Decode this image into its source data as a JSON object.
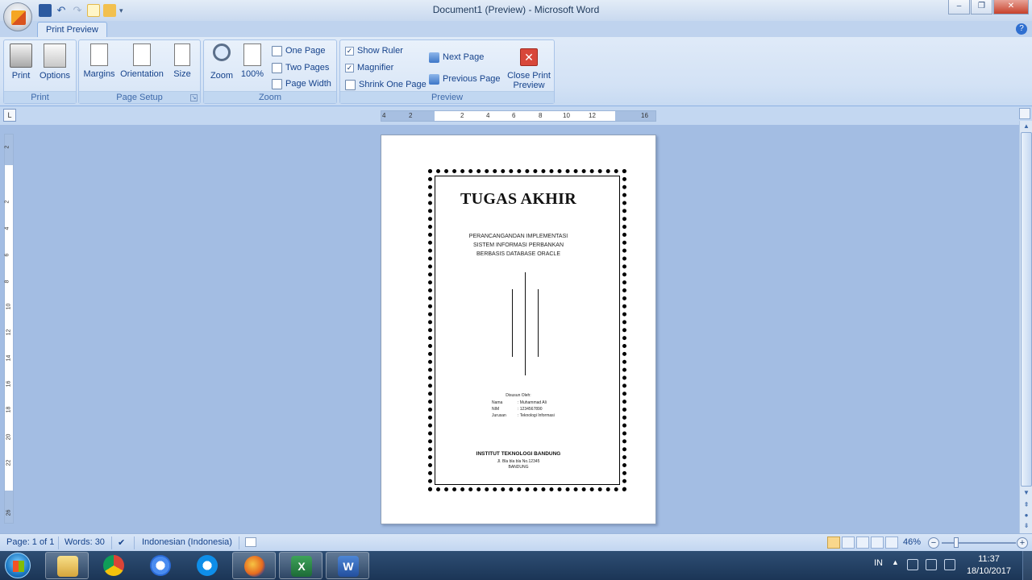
{
  "window": {
    "title": "Document1 (Preview) - Microsoft Word",
    "minimize": "–",
    "restore": "❐",
    "close": "✕"
  },
  "quick_access": {
    "undo": "↶",
    "redo": "↷",
    "more": "▾"
  },
  "ribbon": {
    "active_tab": "Print Preview",
    "help": "?",
    "groups": {
      "print": {
        "label": "Print",
        "print_label": "Print",
        "options_label": "Options"
      },
      "page_setup": {
        "label": "Page Setup",
        "margins_label": "Margins",
        "orientation_label": "Orientation",
        "size_label": "Size"
      },
      "zoom": {
        "label": "Zoom",
        "zoom_label": "Zoom",
        "hundred_label": "100%",
        "one_page_label": "One Page",
        "two_pages_label": "Two Pages",
        "page_width_label": "Page Width"
      },
      "preview": {
        "label": "Preview",
        "show_ruler_label": "Show Ruler",
        "show_ruler_checked": true,
        "magnifier_label": "Magnifier",
        "magnifier_checked": true,
        "shrink_label": "Shrink One Page",
        "next_page_label": "Next Page",
        "previous_page_label": "Previous Page",
        "close_preview_label_1": "Close Print",
        "close_preview_label_2": "Preview"
      }
    }
  },
  "ruler": {
    "tab_selector": "L",
    "h_ticks": [
      "4",
      "2",
      "2",
      "4",
      "6",
      "8",
      "10",
      "12",
      "16"
    ],
    "v_ticks": [
      "2",
      "2",
      "4",
      "6",
      "8",
      "10",
      "12",
      "14",
      "16",
      "18",
      "20",
      "22",
      "26"
    ]
  },
  "document": {
    "title": "TUGAS AKHIR",
    "subtitle_1": "PERANCANGANDAN IMPLEMENTASI",
    "subtitle_2": "SISTEM INFORMASI PERBANKAN",
    "subtitle_3": "BERBASIS DATABASE ORACLE",
    "disusun": "Disusun Oleh:",
    "name_key": "Nama",
    "name_val": ": Muhammad Ali",
    "nim_key": "NIM",
    "nim_val": ": 1234567890",
    "jurusan_key": "Jurusan",
    "jurusan_val": ": Teknologi Informasi",
    "institution": "INSTITUT TEKNOLOGI BANDUNG",
    "address_1": "Jl. Bla bla bla No.12345",
    "address_2": "BANDUNG"
  },
  "statusbar": {
    "page": "Page: 1 of 1",
    "words": "Words: 30",
    "language": "Indonesian (Indonesia)",
    "zoom_level": "46%",
    "zoom_minus": "−",
    "zoom_plus": "+"
  },
  "taskbar": {
    "excel_letter": "X",
    "word_letter": "W",
    "lang": "IN",
    "tray_up": "▲",
    "time": "11:37",
    "date": "18/10/2017"
  },
  "colors": {
    "workspace": "#a3bde3",
    "ribbon": "#dfeaf8",
    "taskbar": "#1b3556",
    "accent": "#15428b"
  }
}
